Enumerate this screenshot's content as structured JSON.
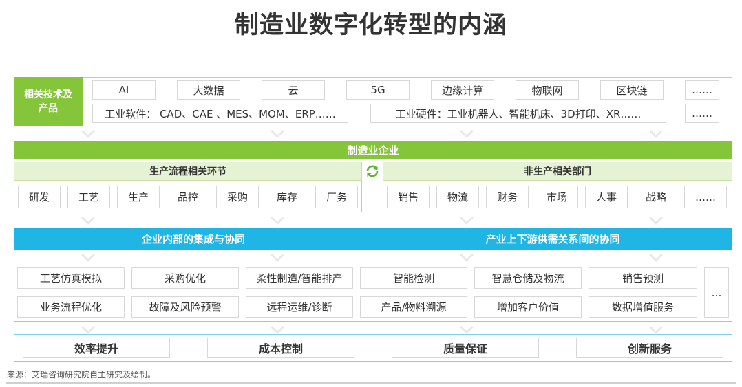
{
  "title": "制造业数字化转型的内涵",
  "tech": {
    "label": "相关技术及产品",
    "row1": [
      "AI",
      "大数据",
      "云",
      "5G",
      "边缘计算",
      "物联网",
      "区块链",
      "……"
    ],
    "software": "工业软件：  CAD、CAE 、MES、MOM、ERP……",
    "hardware": "工业硬件：工业机器人、智能机床、3D打印、XR……",
    "row2_more": "……"
  },
  "enterprise": {
    "title": "制造业企业",
    "production_title": "生产流程相关环节",
    "production_items": [
      "研发",
      "工艺",
      "生产",
      "品控",
      "采购",
      "库存",
      "厂务"
    ],
    "nonprod_title": "非生产相关部门",
    "nonprod_items": [
      "销售",
      "物流",
      "财务",
      "市场",
      "人事",
      "战略",
      "……"
    ],
    "sync_icon": "refresh-cycle-icon"
  },
  "collab": {
    "internal": "企业内部的集成与协同",
    "external": "产业上下游供需关系间的协同"
  },
  "apps": {
    "row1": [
      "工艺仿真模拟",
      "采购优化",
      "柔性制造/智能排产",
      "智能检测",
      "智慧仓储及物流",
      "销售预测"
    ],
    "row2": [
      "业务流程优化",
      "故障及风险预警",
      "远程运维/诊断",
      "产品/物料溯源",
      "增加客户价值",
      "数据增值服务"
    ],
    "more": "…"
  },
  "outcomes": [
    "效率提升",
    "成本控制",
    "质量保证",
    "创新服务"
  ],
  "footer": "来源：艾瑞咨询研究院自主研究及绘制。",
  "colors": {
    "green": "#84c53a",
    "light_green": "#e6f2d4",
    "blue": "#1fb6e6",
    "border": "#d8d8d8"
  }
}
